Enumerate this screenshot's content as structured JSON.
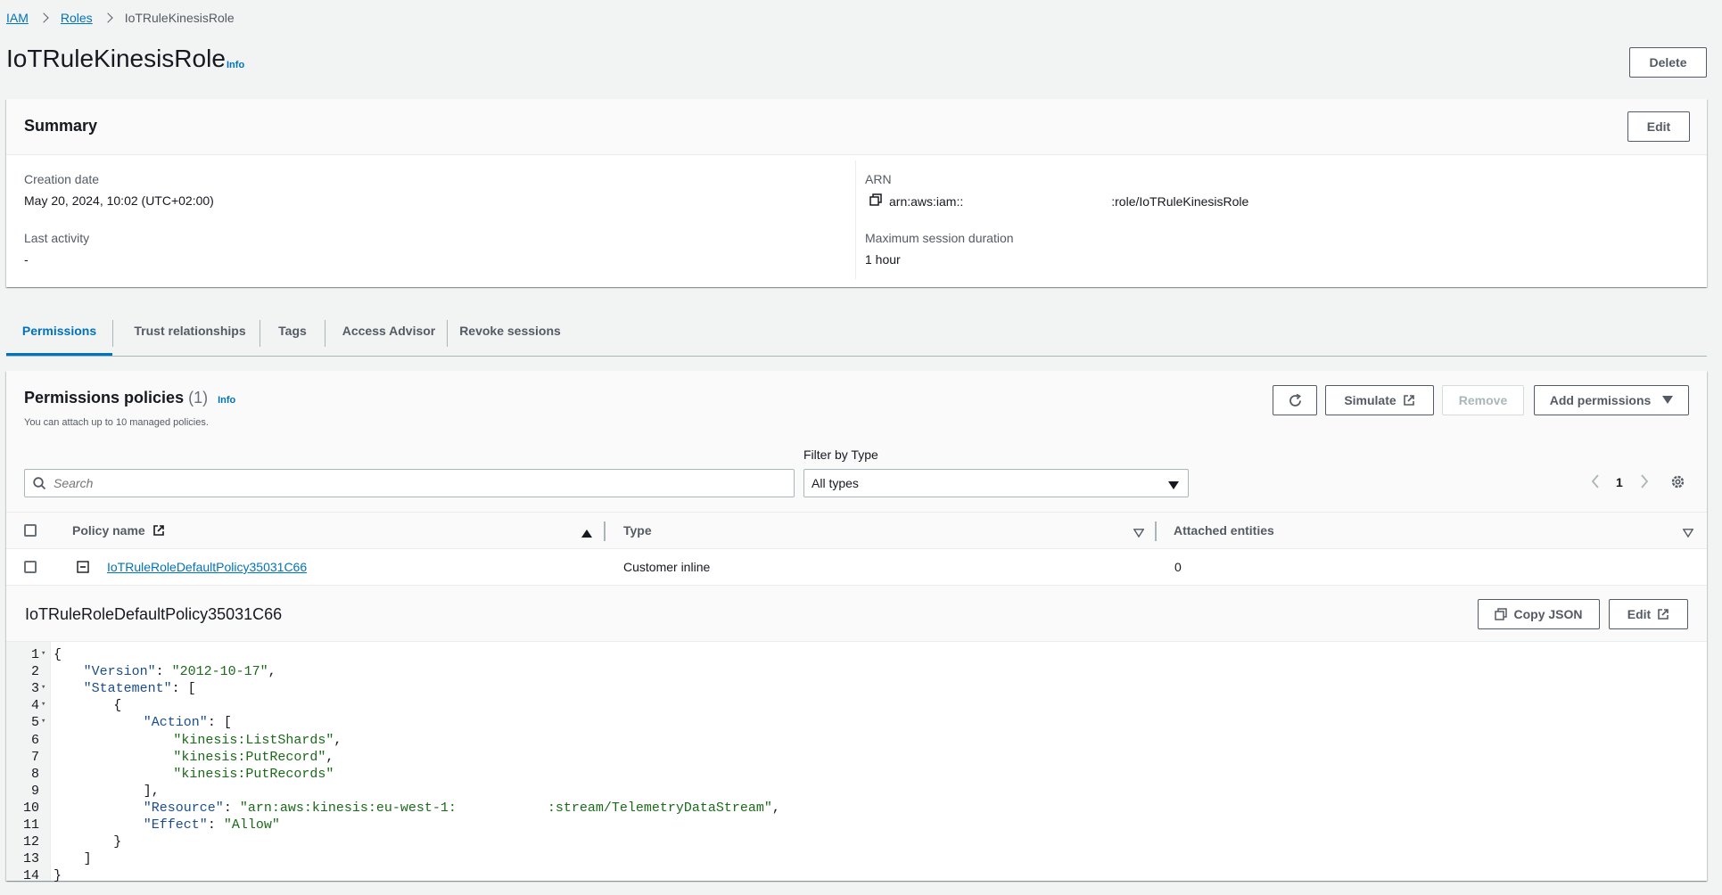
{
  "breadcrumb": {
    "item1": "IAM",
    "item2": "Roles",
    "current": "IoTRuleKinesisRole"
  },
  "header": {
    "title": "IoTRuleKinesisRole",
    "info": "Info",
    "delete_label": "Delete"
  },
  "summary": {
    "title": "Summary",
    "edit_label": "Edit",
    "creation_date_label": "Creation date",
    "creation_date_value": "May 20, 2024, 10:02 (UTC+02:00)",
    "last_activity_label": "Last activity",
    "last_activity_value": "-",
    "arn_label": "ARN",
    "arn_prefix": "arn:aws:iam::",
    "arn_suffix": ":role/IoTRuleKinesisRole",
    "max_session_label": "Maximum session duration",
    "max_session_value": "1 hour"
  },
  "tabs": {
    "permissions": "Permissions",
    "trust": "Trust relationships",
    "tags": "Tags",
    "access_advisor": "Access Advisor",
    "revoke": "Revoke sessions"
  },
  "permissions": {
    "title": "Permissions policies",
    "count": "(1)",
    "info": "Info",
    "subtitle": "You can attach up to 10 managed policies.",
    "simulate_label": "Simulate",
    "remove_label": "Remove",
    "add_label": "Add permissions",
    "search_placeholder": "Search",
    "filter_label": "Filter by Type",
    "filter_value": "All types",
    "page_number": "1",
    "columns": {
      "policy_name": "Policy name",
      "type": "Type",
      "attached": "Attached entities"
    },
    "rows": [
      {
        "name": "IoTRuleRoleDefaultPolicy35031C66",
        "type": "Customer inline",
        "attached": "0"
      }
    ],
    "detail_title": "IoTRuleRoleDefaultPolicy35031C66",
    "copy_json_label": "Copy JSON",
    "edit_label": "Edit"
  },
  "policy_json": {
    "l1": "{",
    "l2_key": "\"Version\"",
    "l2_val": "\"2012-10-17\"",
    "l3_key": "\"Statement\"",
    "l3_rest": ": [",
    "l4": "{",
    "l5_key": "\"Action\"",
    "l5_rest": ": [",
    "l6": "\"kinesis:ListShards\"",
    "l7": "\"kinesis:PutRecord\"",
    "l8": "\"kinesis:PutRecords\"",
    "l9": "],",
    "l10_key": "\"Resource\"",
    "l10_val_a": "\"arn:aws:kinesis:eu-west-1:",
    "l10_val_b": ":stream/TelemetryDataStream\"",
    "l11_key": "\"Effect\"",
    "l11_val": "\"Allow\"",
    "l12": "}",
    "l13": "]",
    "l14": "}"
  },
  "line_numbers": [
    "1",
    "2",
    "3",
    "4",
    "5",
    "6",
    "7",
    "8",
    "9",
    "10",
    "11",
    "12",
    "13",
    "14"
  ],
  "colors": {
    "link": "#0073bb",
    "text": "#16191f",
    "muted": "#545b64",
    "background": "#f2f3f3"
  }
}
